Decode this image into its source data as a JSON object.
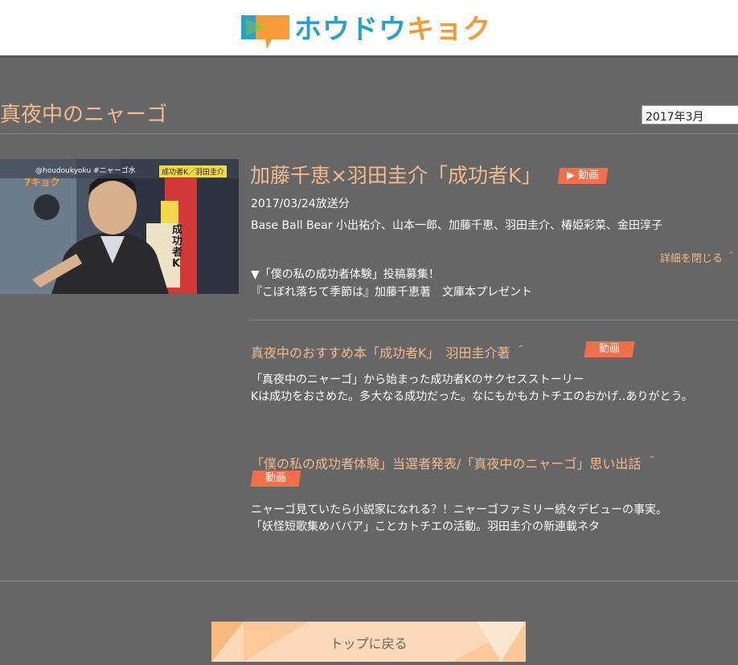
{
  "header": {
    "logo_blue": "ホウドウ",
    "logo_orange": "キョク"
  },
  "program": {
    "title": "真夜中のニャーゴ",
    "month_select": "2017年3月"
  },
  "episode": {
    "title": "加藤千恵×羽田圭介「成功者K」",
    "video_badge": "▶ 動画",
    "thumb_handle": "@houdoukyoku #ニャーゴ水",
    "thumb_tag": "成功者K／羽田圭介",
    "thumb_logo": "7キョク",
    "thumb_book": "成功者K",
    "broadcast": "2017/03/24放送分",
    "cast": "Base Ball Bear 小出祐介、山本一郎、加藤千恵、羽田圭介、椿姫彩菜、金田淳子",
    "detail_toggle": "詳細を閉じる ＾",
    "notice_1": "▼「僕の私の成功者体験」投稿募集！",
    "notice_2": "『こぼれ落ちて季節は』加藤千恵著　文庫本プレゼント"
  },
  "segments": [
    {
      "title": "真夜中のおすすめ本「成功者K」　羽田圭介著 ＾",
      "badge": "動画",
      "line_1": "「真夜中のニャーゴ」から始まった成功者Kのサクセスストーリー",
      "line_2": "Kは成功をおさめた。多大なる成功だった。なにもかもカトチエのおかげ‥ありがとう。"
    },
    {
      "title": "「僕の私の成功者体験」当選者発表/「真夜中のニャーゴ」思い出話 ＾",
      "badge": "動画",
      "line_1": "ニャーゴ見ていたら小説家になれる？！ニャーゴファミリー続々デビューの事実。",
      "line_2": "「妖怪短歌集めババア」ことカトチエの活動。羽田圭介の新連載ネタ"
    }
  ],
  "footer": {
    "back_to_top": "トップに戻る"
  },
  "colors": {
    "background": "#666666",
    "accent_orange": "#f5b98a",
    "badge_red": "#ef6e4b",
    "logo_blue": "#2aa0c6",
    "logo_orange": "#f39a3b"
  }
}
